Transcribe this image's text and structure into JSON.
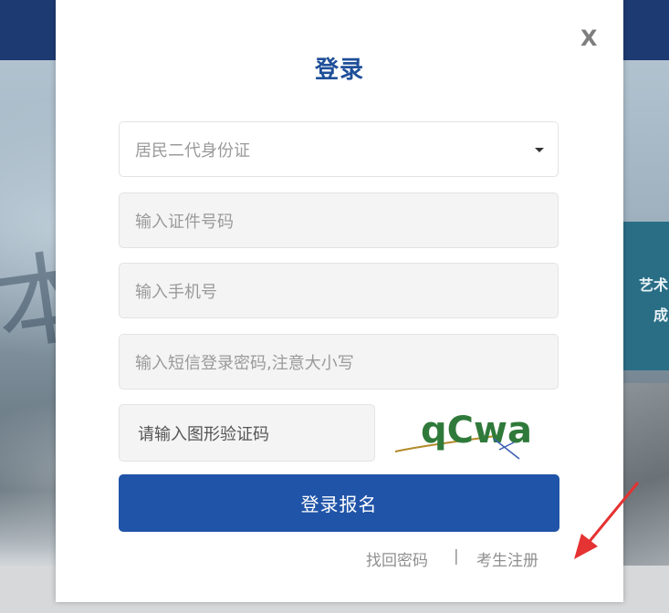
{
  "background": {
    "calligraphy_char": "本",
    "side_text": [
      "艺术",
      "成"
    ]
  },
  "modal": {
    "title": "登录",
    "close_label": "X"
  },
  "form": {
    "id_type": "居民二代身份证",
    "id_number_placeholder": "输入证件号码",
    "phone_placeholder": "输入手机号",
    "sms_password_placeholder": "输入短信登录密码,注意大小写",
    "captcha_placeholder": "请输入图形验证码",
    "captcha_text": "qCwa",
    "submit_label": "登录报名"
  },
  "links": {
    "recover_password": "找回密码",
    "separator": "|",
    "register": "考生注册"
  },
  "colors": {
    "accent": "#2054a8",
    "title": "#1f4f98",
    "annotation_arrow": "#e53232"
  }
}
